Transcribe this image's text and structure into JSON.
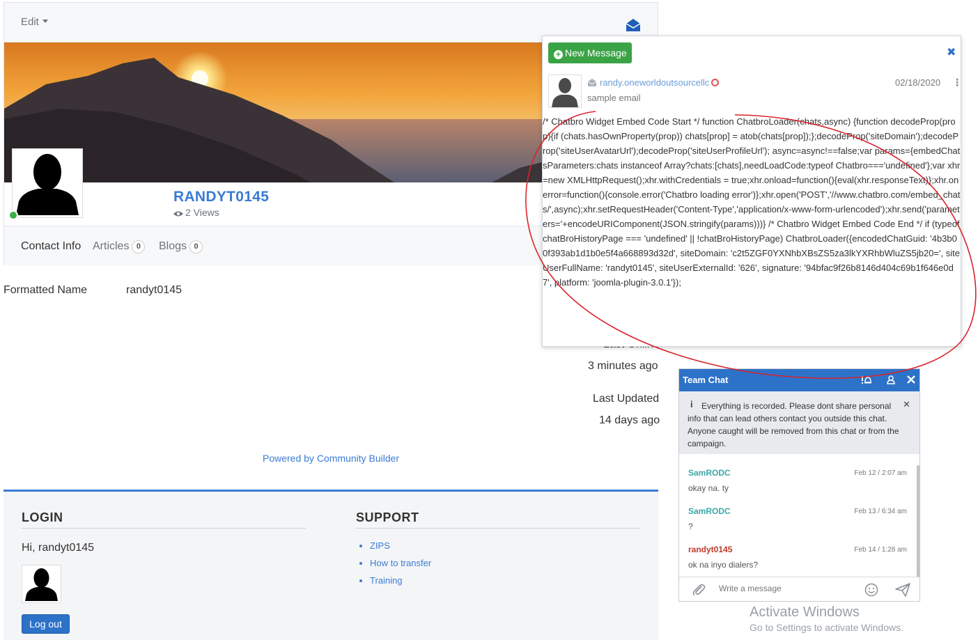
{
  "header": {
    "edit_label": "Edit"
  },
  "profile": {
    "username": "RANDYT0145",
    "views": "2 Views"
  },
  "tabs": [
    {
      "label": "Contact Info",
      "count": ""
    },
    {
      "label": "Articles",
      "count": "0"
    },
    {
      "label": "Blogs",
      "count": "0"
    }
  ],
  "fields": {
    "formatted_name_label": "Formatted Name",
    "formatted_name_value": "randyt0145",
    "last_online_label": "Last Online",
    "last_online_value": "3 minutes ago",
    "last_updated_label": "Last Updated",
    "last_updated_value": "14 days ago"
  },
  "powered_by": "Powered by Community Builder",
  "footer": {
    "login_title": "LOGIN",
    "greeting": "Hi, randyt0145",
    "logout_label": "Log out",
    "support_title": "SUPPORT",
    "support_links": [
      "ZIPS",
      "How to transfer",
      "Training"
    ]
  },
  "message_popup": {
    "new_message_label": "New Message",
    "close_glyph": "✖",
    "sender": "randy.oneworldoutsourcellc",
    "date": "02/18/2020",
    "subject": "sample email",
    "body": "/* Chatbro Widget Embed Code Start */ function ChatbroLoader(chats,async) {function decodeProp(prop){if (chats.hasOwnProperty(prop)) chats[prop] = atob(chats[prop]);};decodeProp('siteDomain');decodeProp('siteUserAvatarUrl');decodeProp('siteUserProfileUrl'); async=async!==false;var params={embedChatsParameters:chats instanceof Array?chats:[chats],needLoadCode:typeof Chatbro==='undefined'};var xhr=new XMLHttpRequest();xhr.withCredentials = true;xhr.onload=function(){eval(xhr.responseText)};xhr.onerror=function(){console.error('Chatbro loading error')};xhr.open('POST','//www.chatbro.com/embed_chats/',async);xhr.setRequestHeader('Content-Type','application/x-www-form-urlencoded');xhr.send('parameters='+encodeURIComponent(JSON.stringify(params)))} /* Chatbro Widget Embed Code End */ if (typeof chatBroHistoryPage === 'undefined' || !chatBroHistoryPage) ChatbroLoader({encodedChatGuid: '4b3b00f393ab1d1b0e5f4a668893d32d', siteDomain: 'c2t5ZGF0YXNhbXBsZS5za3lkYXRhbWluZS5jb20=', siteUserFullName: 'randyt0145', siteUserExternalId: '626', signature: '94bfac9f26b8146d404c69b1f646e0d7', platform: 'joomla-plugin-3.0.1'});"
  },
  "team_chat": {
    "title": "Team Chat",
    "notice": "Everything is recorded. Please dont share personal info that can lead others contact you outside this chat. Anyone caught will be removed from this chat or from the campaign.",
    "messages": [
      {
        "user": "SamRODC",
        "time": "Feb 12 / 2:07 am",
        "text": "okay na. ty",
        "color": "#3aa8a8"
      },
      {
        "user": "SamRODC",
        "time": "Feb 13 / 6:34 am",
        "text": "?",
        "color": "#3aa8a8"
      },
      {
        "user": "randyt0145",
        "time": "Feb 14 / 1:28 am",
        "text": "ok na inyo dialers?",
        "color": "#c0392b"
      }
    ],
    "input_placeholder": "Write a message"
  },
  "watermark": {
    "title": "Activate Windows",
    "subtitle": "Go to Settings to activate Windows."
  },
  "colors": {
    "accent": "#3a7bd5",
    "chat_header": "#2d72c9",
    "new_message_button": "#3aa345",
    "annotation": "#d9232a"
  }
}
